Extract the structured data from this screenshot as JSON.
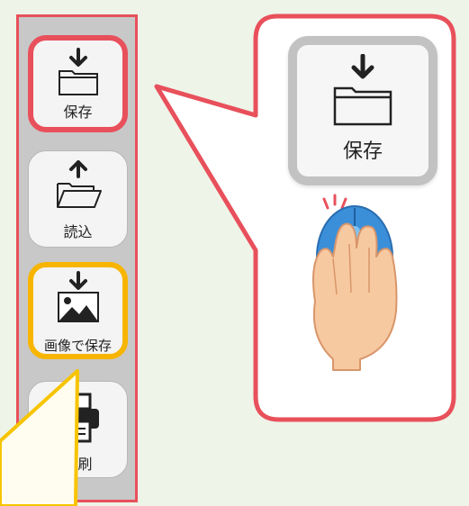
{
  "toolbar": {
    "save_label": "保存",
    "load_label": "読込",
    "image_save_label": "画像で保存",
    "print_label": "印刷"
  },
  "callout": {
    "zoom_label": "保存"
  },
  "colors": {
    "background": "#eef4e8",
    "highlight_red": "#e8505b",
    "highlight_yellow": "#f7b500",
    "mouse_blue": "#3b8fd9",
    "skin": "#f7c9a0"
  },
  "icons": [
    "save-icon",
    "open-folder-icon",
    "image-download-icon",
    "printer-icon",
    "mouse-click-hand-icon"
  ]
}
